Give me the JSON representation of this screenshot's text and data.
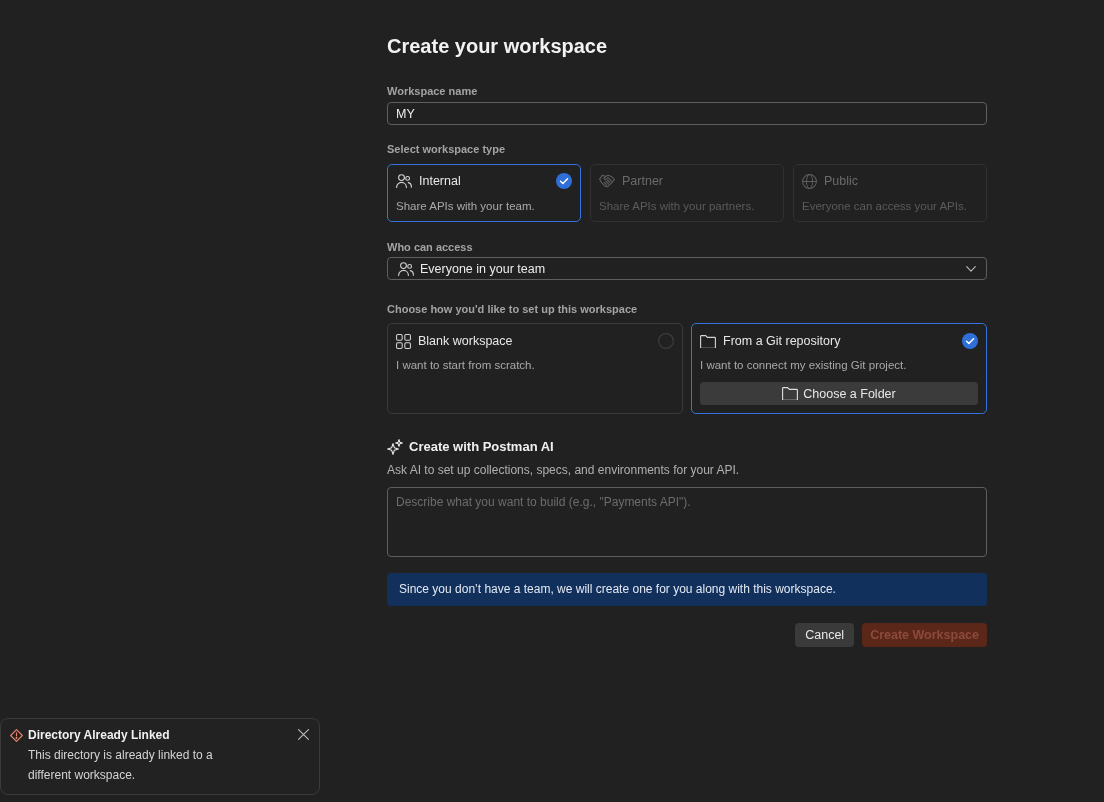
{
  "title": "Create your workspace",
  "workspace_name": {
    "label": "Workspace name",
    "value": "MY"
  },
  "workspace_type": {
    "label": "Select workspace type",
    "options": [
      {
        "title": "Internal",
        "description": "Share APIs with your team.",
        "selected": true,
        "disabled": false
      },
      {
        "title": "Partner",
        "description": "Share APIs with your partners.",
        "selected": false,
        "disabled": true
      },
      {
        "title": "Public",
        "description": "Everyone can access your APIs.",
        "selected": false,
        "disabled": true
      }
    ]
  },
  "access": {
    "label": "Who can access",
    "value": "Everyone in your team"
  },
  "setup": {
    "label": "Choose how you'd like to set up this workspace",
    "options": [
      {
        "title": "Blank workspace",
        "description": "I want to start from scratch.",
        "selected": false
      },
      {
        "title": "From a Git repository",
        "description": "I want to connect my existing Git project.",
        "selected": true,
        "action": "Choose a Folder"
      }
    ]
  },
  "ai": {
    "title": "Create with Postman AI",
    "description": "Ask AI to set up collections, specs, and environments for your API.",
    "prompt": {
      "placeholder": "Describe what you want to build (e.g., \"Payments API\")."
    }
  },
  "notice": {
    "text": "Since you don’t have a team, we will create one for you along with this workspace."
  },
  "buttons": [
    {
      "label": "Cancel",
      "kind": "secondary",
      "disabled": false
    },
    {
      "label": "Create Workspace",
      "kind": "primary",
      "disabled": true
    }
  ],
  "toast": {
    "title": "Directory Already Linked",
    "message": "This directory is already linked to a different workspace."
  }
}
